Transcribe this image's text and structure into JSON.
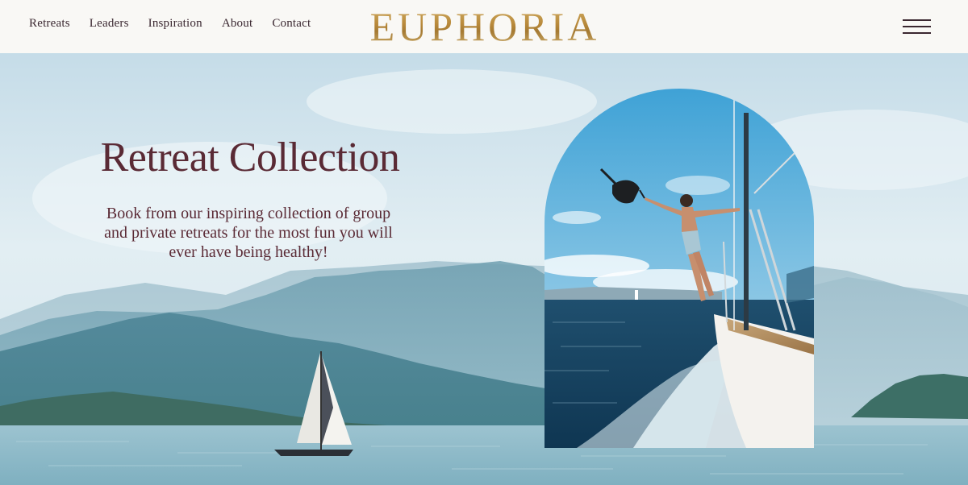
{
  "nav": {
    "items": [
      "Retreats",
      "Leaders",
      "Inspiration",
      "About",
      "Contact"
    ]
  },
  "brand": {
    "logo_text": "EUPHORIA",
    "logo_color": "#b8893a"
  },
  "hero": {
    "title": "Retreat Collection",
    "subtitle": "Book from our inspiring collection of group and private retreats for the most fun you will ever have being healthy!",
    "text_color": "#5a2a35"
  },
  "icons": {
    "menu": "hamburger-menu-icon"
  }
}
